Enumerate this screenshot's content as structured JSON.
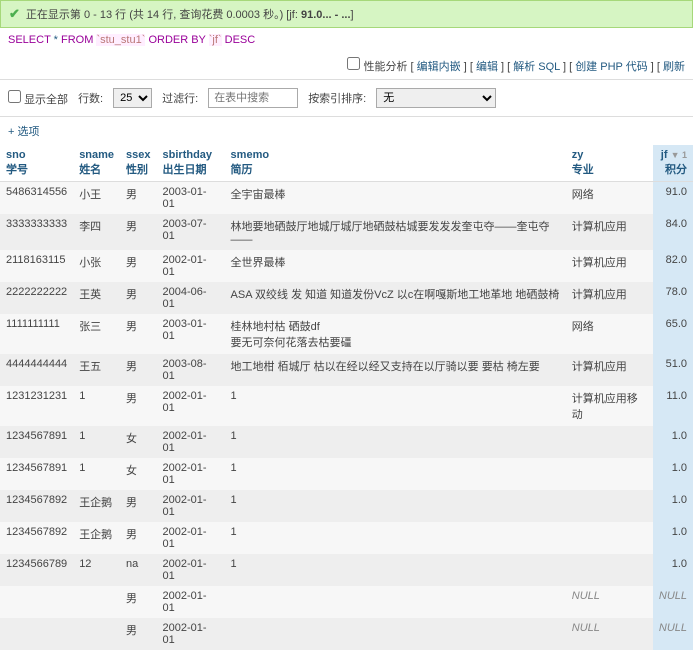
{
  "status": {
    "prefix": "正在显示第 0 - 13 行 (共 14 行, 查询花费 0.0003 秒。) [jf:",
    "bold": "91.0... - ...",
    "suffix": "]"
  },
  "sql": {
    "select": "SELECT",
    "star": "*",
    "from": "FROM",
    "t": "`stu_stu1`",
    "order": "ORDER BY",
    "c": "`jf`",
    "desc": "DESC"
  },
  "tb": {
    "perf": "性能分析",
    "a1": "编辑内嵌",
    "a2": "编辑",
    "a3": "解析 SQL",
    "a4": "创建 PHP 代码",
    "a5": "刷新"
  },
  "ctr": {
    "all": "显示全部",
    "rows": "行数:",
    "rv": "25",
    "filter": "过滤行:",
    "ph": "在表中搜索",
    "sort": "按索引排序:",
    "none": "无"
  },
  "opt": "+ 选项",
  "h": {
    "sno": {
      "a": "sno",
      "b": "学号"
    },
    "sname": {
      "a": "sname",
      "b": "姓名"
    },
    "ssex": {
      "a": "ssex",
      "b": "性别"
    },
    "sbd": {
      "a": "sbirthday",
      "b": "出生日期"
    },
    "smemo": {
      "a": "smemo",
      "b": "简历"
    },
    "zy": {
      "a": "zy",
      "b": "专业"
    },
    "jf": {
      "a": "jf",
      "b": "积分",
      "s": "▼ 1"
    }
  },
  "r": [
    {
      "sno": "5486314556",
      "sn": "小王",
      "sx": "男",
      "bd": "2003-01-01",
      "m": "全宇宙最棒",
      "zy": "网络",
      "jf": "91.0"
    },
    {
      "sno": "3333333333",
      "sn": "李四",
      "sx": "男",
      "bd": "2003-07-01",
      "m": "林地要地硒鼓厅地城厅城厅地硒鼓枯城要发发发奎屯夺——奎屯夺——",
      "zy": "计算机应用",
      "jf": "84.0"
    },
    {
      "sno": "2118163115",
      "sn": "小张",
      "sx": "男",
      "bd": "2002-01-01",
      "m": "全世界最棒",
      "zy": "计算机应用",
      "jf": "82.0"
    },
    {
      "sno": "2222222222",
      "sn": "王英",
      "sx": "男",
      "bd": "2004-06-01",
      "m": "ASA 双绞线  发 知道 知道发份VcZ 以c在啊嘎斯地工地革地 地硒鼓椅",
      "zy": "计算机应用",
      "jf": "78.0"
    },
    {
      "sno": "1111111111",
      "sn": "张三",
      "sx": "男",
      "bd": "2003-01-01",
      "m": "桂林地村枯 硒鼓df\n要无可奈何花落去枯要礓",
      "zy": "网络",
      "jf": "65.0"
    },
    {
      "sno": "4444444444",
      "sn": "王五",
      "sx": "男",
      "bd": "2003-08-01",
      "m": "地工地柑 栢城厅 枯以在经以经又支持在以厅骑以要 要枯  椅左要",
      "zy": "计算机应用",
      "jf": "51.0"
    },
    {
      "sno": "1231231231",
      "sn": "1",
      "sx": "男",
      "bd": "2002-01-01",
      "m": "1",
      "zy": "计算机应用移动",
      "jf": "11.0"
    },
    {
      "sno": "1234567891",
      "sn": "1",
      "sx": "女",
      "bd": "2002-01-01",
      "m": "1",
      "zy": "",
      "jf": "1.0"
    },
    {
      "sno": "1234567891",
      "sn": "1",
      "sx": "女",
      "bd": "2002-01-01",
      "m": "1",
      "zy": "",
      "jf": "1.0"
    },
    {
      "sno": "1234567892",
      "sn": "王企鹅",
      "sx": "男",
      "bd": "2002-01-01",
      "m": "1",
      "zy": "",
      "jf": "1.0"
    },
    {
      "sno": "1234567892",
      "sn": "王企鹅",
      "sx": "男",
      "bd": "2002-01-01",
      "m": "1",
      "zy": "",
      "jf": "1.0"
    },
    {
      "sno": "1234566789",
      "sn": "12",
      "sx": "na",
      "bd": "2002-01-01",
      "m": "1",
      "zy": "",
      "jf": "1.0"
    },
    {
      "sno": "",
      "sn": "",
      "sx": "男",
      "bd": "2002-01-01",
      "m": "",
      "zy": "NULL",
      "jf": "NULL",
      "null": true
    },
    {
      "sno": "",
      "sn": "",
      "sx": "男",
      "bd": "2002-01-01",
      "m": "",
      "zy": "NULL",
      "jf": "NULL",
      "null": true
    }
  ]
}
